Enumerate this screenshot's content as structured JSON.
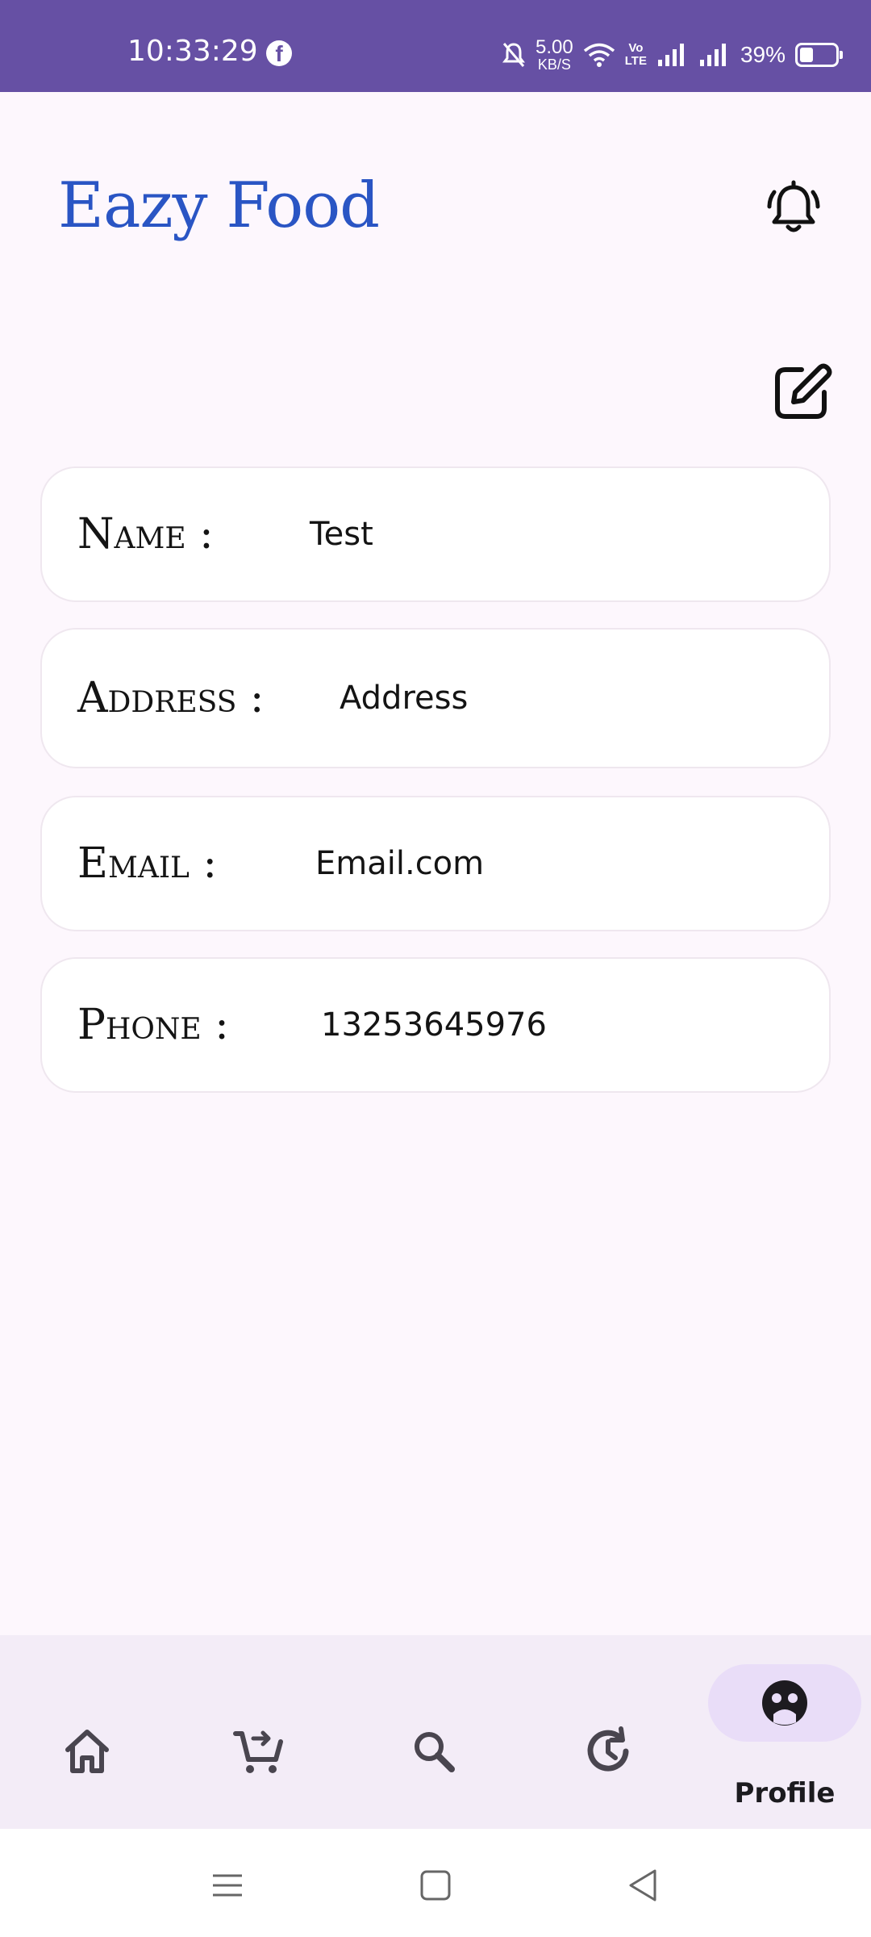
{
  "status_bar": {
    "time": "10:33:29",
    "facebook_glyph": "f",
    "net_speed_value": "5.00",
    "net_speed_unit": "KB/S",
    "volte_line1": "Vo",
    "volte_line2": "LTE",
    "battery_percent": "39%",
    "battery_level": 0.39
  },
  "header": {
    "title": "Eazy Food"
  },
  "profile": {
    "fields": [
      {
        "label": "Name :",
        "value": "Test"
      },
      {
        "label": "Address :",
        "value": "Address"
      },
      {
        "label": "Email :",
        "value": "Email.com"
      },
      {
        "label": "Phone :",
        "value": "13253645976"
      }
    ]
  },
  "bottom_nav": {
    "items": [
      {
        "icon": "home-icon"
      },
      {
        "icon": "cart-icon"
      },
      {
        "icon": "search-icon"
      },
      {
        "icon": "history-icon"
      },
      {
        "icon": "profile-face-icon",
        "label": "Profile",
        "selected": true
      }
    ],
    "active_pill_color": "#e9ddf8"
  },
  "colors": {
    "status_bar": "#6650a4",
    "title": "#2a55c4",
    "background": "#fdf7fd",
    "nav_background": "#f3ecf7"
  }
}
